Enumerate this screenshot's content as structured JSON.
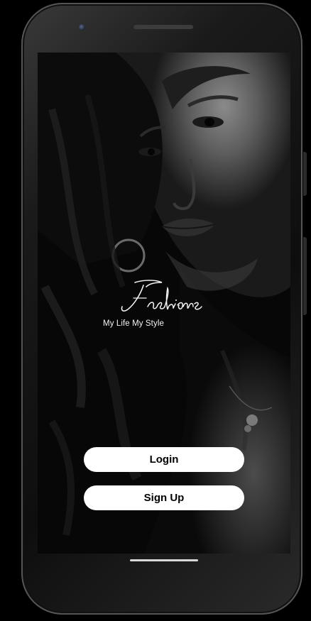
{
  "logo": {
    "wordmark": "Fashions",
    "tagline": "My Life My Style"
  },
  "actions": {
    "login_label": "Login",
    "signup_label": "Sign Up"
  },
  "colors": {
    "background": "#000000",
    "button_fill": "#ffffff",
    "button_text": "#000000",
    "text_light": "#f2f2f2"
  }
}
